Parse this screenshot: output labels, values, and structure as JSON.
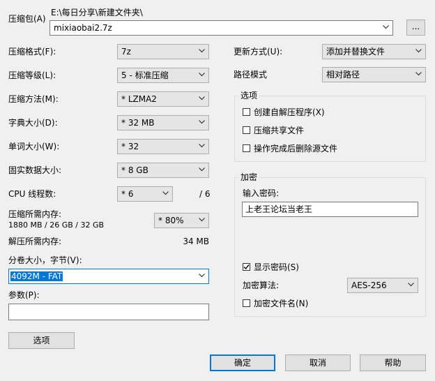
{
  "archive": {
    "label": "压缩包(A)",
    "path": "E:\\每日分享\\新建文件夹\\",
    "filename": "mixiaobai2.7z",
    "browse_label": "..."
  },
  "left": {
    "format": {
      "label": "压缩格式(F):",
      "value": "7z"
    },
    "level": {
      "label": "压缩等级(L):",
      "value": "5 - 标准压缩"
    },
    "method": {
      "label": "压缩方法(M):",
      "value": "* LZMA2"
    },
    "dict": {
      "label": "字典大小(D):",
      "value": "* 32 MB"
    },
    "word": {
      "label": "单词大小(W):",
      "value": "* 32"
    },
    "solid": {
      "label": "固实数据大小:",
      "value": "* 8 GB"
    },
    "cpu": {
      "label": "CPU 线程数:",
      "value": "* 6",
      "total": "/ 6"
    },
    "mem_comp": {
      "label": "压缩所需内存:",
      "detail": "1880 MB / 26 GB / 32 GB",
      "value": "* 80%"
    },
    "mem_decomp": {
      "label": "解压所需内存:",
      "value": "34 MB"
    },
    "volume": {
      "label": "分卷大小，字节(V):",
      "value": "4092M - FAT"
    },
    "params": {
      "label": "参数(P):",
      "value": ""
    },
    "options_button": "选项"
  },
  "right": {
    "update": {
      "label": "更新方式(U):",
      "value": "添加并替换文件"
    },
    "pathmode": {
      "label": "路径模式",
      "value": "相对路径"
    },
    "options_group": {
      "title": "选项",
      "sfx": "创建自解压程序(X)",
      "shared": "压缩共享文件",
      "delete": "操作完成后删除源文件"
    },
    "encrypt_group": {
      "title": "加密",
      "pwd_label": "输入密码:",
      "pwd_value": "上老王论坛当老王",
      "show_pwd": "显示密码(S)",
      "show_pwd_checked": true,
      "method_label": "加密算法:",
      "method_value": "AES-256",
      "encrypt_names": "加密文件名(N)"
    }
  },
  "buttons": {
    "ok": "确定",
    "cancel": "取消",
    "help": "帮助"
  }
}
